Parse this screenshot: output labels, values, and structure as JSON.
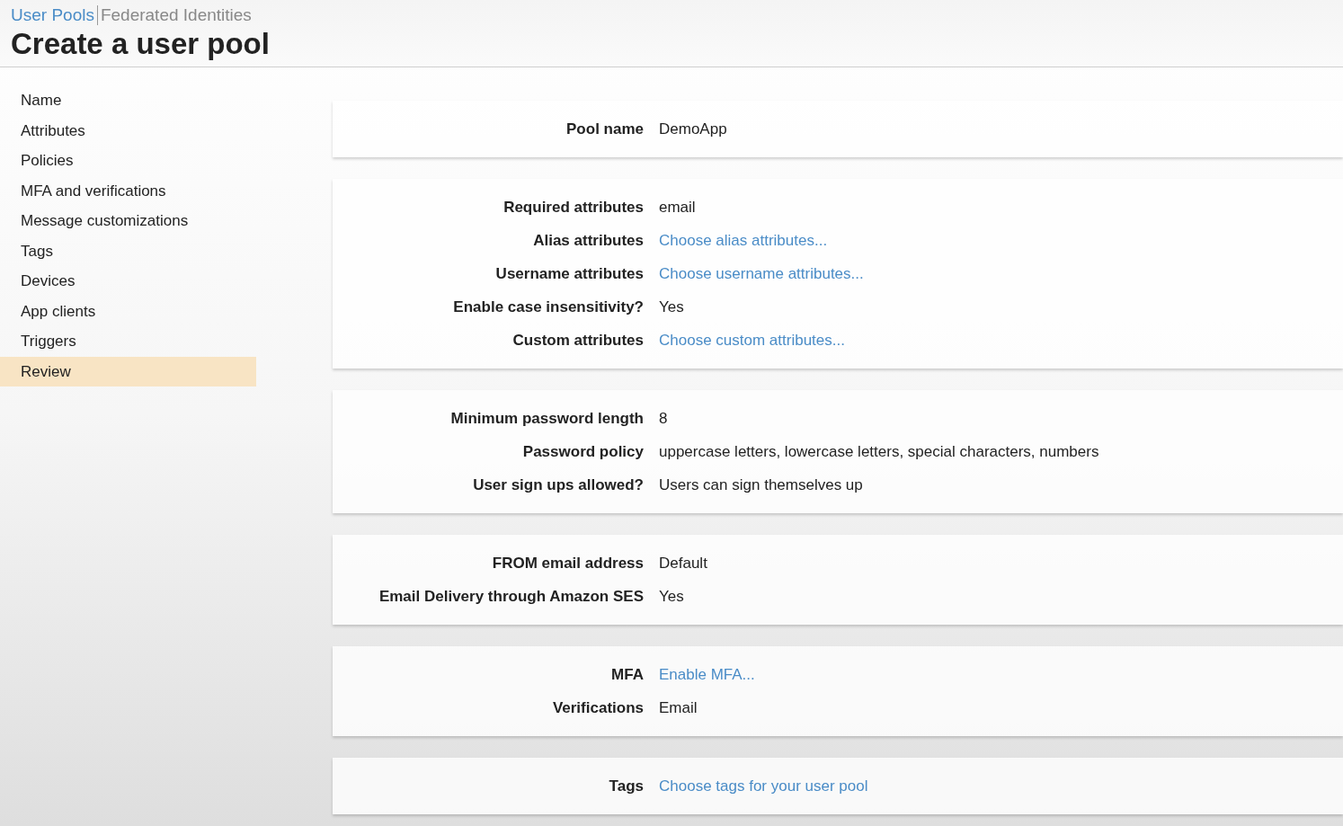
{
  "breadcrumb": [
    {
      "label": "User Pools",
      "selected": true
    },
    {
      "label": "Federated Identities",
      "selected": false
    }
  ],
  "title": "Create a user pool",
  "sidebar": {
    "items": [
      {
        "label": "Name",
        "selected": false
      },
      {
        "label": "Attributes",
        "selected": false
      },
      {
        "label": "Policies",
        "selected": false
      },
      {
        "label": "MFA and verifications",
        "selected": false
      },
      {
        "label": "Message customizations",
        "selected": false
      },
      {
        "label": "Tags",
        "selected": false
      },
      {
        "label": "Devices",
        "selected": false
      },
      {
        "label": "App clients",
        "selected": false
      },
      {
        "label": "Triggers",
        "selected": false
      },
      {
        "label": "Review",
        "selected": true
      }
    ]
  },
  "sections": [
    {
      "rows": [
        {
          "label": "Pool name",
          "value": "DemoApp",
          "kind": "text"
        }
      ]
    },
    {
      "rows": [
        {
          "label": "Required attributes",
          "value": "email",
          "kind": "text"
        },
        {
          "label": "Alias attributes",
          "value": "Choose alias attributes...",
          "kind": "link"
        },
        {
          "label": "Username attributes",
          "value": "Choose username attributes...",
          "kind": "link"
        },
        {
          "label": "Enable case insensitivity?",
          "value": "Yes",
          "kind": "text"
        },
        {
          "label": "Custom attributes",
          "value": "Choose custom attributes...",
          "kind": "link"
        }
      ]
    },
    {
      "rows": [
        {
          "label": "Minimum password length",
          "value": "8",
          "kind": "text"
        },
        {
          "label": "Password policy",
          "value": "uppercase letters, lowercase letters, special characters, numbers",
          "kind": "text"
        },
        {
          "label": "User sign ups allowed?",
          "value": "Users can sign themselves up",
          "kind": "text"
        }
      ]
    },
    {
      "rows": [
        {
          "label": "FROM email address",
          "value": "Default",
          "kind": "text"
        },
        {
          "label": "Email Delivery through Amazon SES",
          "value": "Yes",
          "kind": "text"
        }
      ]
    },
    {
      "rows": [
        {
          "label": "MFA",
          "value": "Enable MFA...",
          "kind": "link"
        },
        {
          "label": "Verifications",
          "value": "Email",
          "kind": "text"
        }
      ]
    },
    {
      "rows": [
        {
          "label": "Tags",
          "value": "Choose tags for your user pool",
          "kind": "link"
        }
      ]
    }
  ]
}
